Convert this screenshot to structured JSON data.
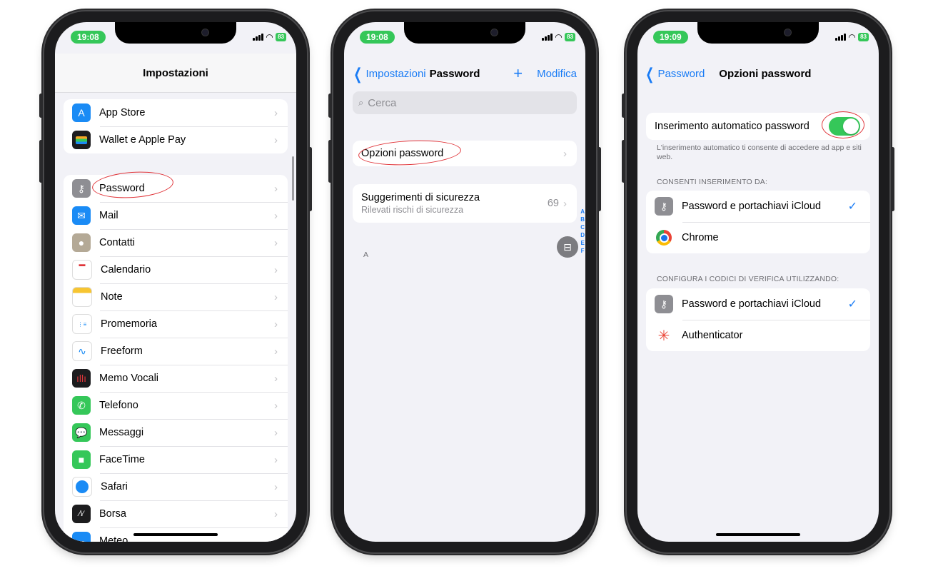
{
  "phone1": {
    "time": "19:08",
    "battery": "83",
    "title": "Impostazioni",
    "group1": [
      {
        "label": "App Store",
        "icon": "app-store-icon",
        "color": "#1a8bf5"
      },
      {
        "label": "Wallet e Apple Pay",
        "icon": "wallet-icon",
        "color": "#1c1c1e"
      }
    ],
    "group2": [
      {
        "label": "Password",
        "icon": "key-icon",
        "color": "#8e8e93"
      },
      {
        "label": "Mail",
        "icon": "mail-icon",
        "color": "#1a8bf5"
      },
      {
        "label": "Contatti",
        "icon": "contacts-icon",
        "color": "#b4a996"
      },
      {
        "label": "Calendario",
        "icon": "calendar-icon",
        "color": "#ffffff"
      },
      {
        "label": "Note",
        "icon": "notes-icon",
        "color": "#ffffff"
      },
      {
        "label": "Promemoria",
        "icon": "reminders-icon",
        "color": "#ffffff"
      },
      {
        "label": "Freeform",
        "icon": "freeform-icon",
        "color": "#ffffff"
      },
      {
        "label": "Memo Vocali",
        "icon": "voice-memos-icon",
        "color": "#1c1c1e"
      },
      {
        "label": "Telefono",
        "icon": "phone-icon",
        "color": "#35c759"
      },
      {
        "label": "Messaggi",
        "icon": "messages-icon",
        "color": "#35c759"
      },
      {
        "label": "FaceTime",
        "icon": "facetime-icon",
        "color": "#35c759"
      },
      {
        "label": "Safari",
        "icon": "safari-icon",
        "color": "#ffffff"
      },
      {
        "label": "Borsa",
        "icon": "stocks-icon",
        "color": "#1c1c1e"
      },
      {
        "label": "Meteo",
        "icon": "weather-icon",
        "color": "#1a8bf5"
      }
    ]
  },
  "phone2": {
    "time": "19:08",
    "battery": "83",
    "back_label": "Impostazioni",
    "title": "Password",
    "add_label": "+",
    "edit_label": "Modifica",
    "search_placeholder": "Cerca",
    "options_label": "Opzioni password",
    "security_title": "Suggerimenti di sicurezza",
    "security_subtitle": "Rilevati rischi di sicurezza",
    "security_count": "69",
    "section_letter": "A",
    "index_letters": [
      "A",
      "B",
      "C",
      "D",
      "E",
      "F"
    ]
  },
  "phone3": {
    "time": "19:09",
    "battery": "83",
    "back_label": "Password",
    "title": "Opzioni password",
    "autofill_label": "Inserimento automatico password",
    "autofill_on": true,
    "autofill_note": "L'inserimento automatico ti consente di accedere ad app e siti web.",
    "allow_header": "CONSENTI INSERIMENTO DA:",
    "allow_items": [
      {
        "label": "Password e portachiavi iCloud",
        "checked": true
      },
      {
        "label": "Chrome",
        "checked": false
      }
    ],
    "codes_header": "CONFIGURA I CODICI DI VERIFICA UTILIZZANDO:",
    "codes_items": [
      {
        "label": "Password e portachiavi iCloud",
        "checked": true
      },
      {
        "label": "Authenticator",
        "checked": false
      }
    ]
  },
  "colors": {
    "accent": "#1a7cf5",
    "green": "#35c759",
    "annotation": "#e0353a"
  }
}
